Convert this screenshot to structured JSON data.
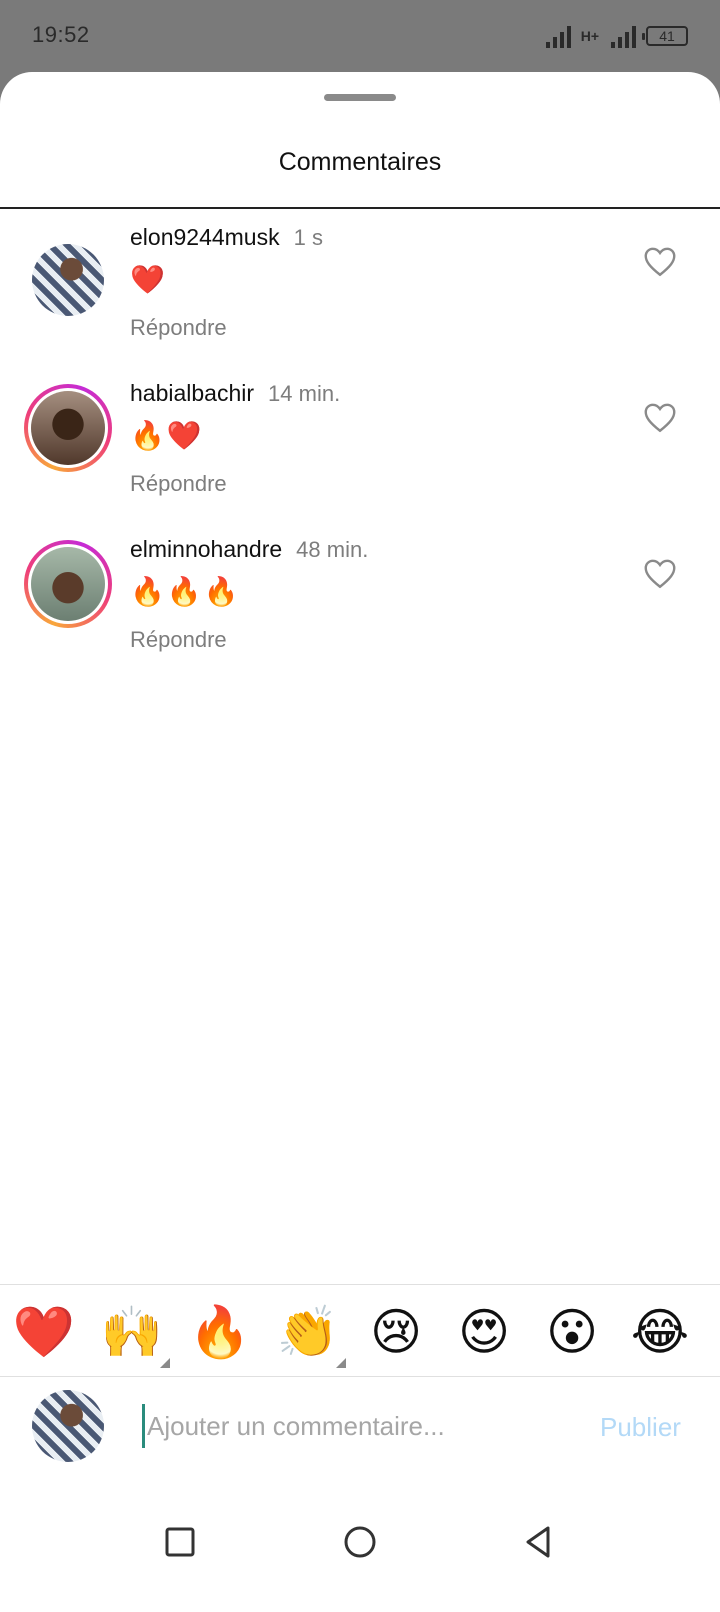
{
  "status_bar": {
    "time": "19:52",
    "network": "H+",
    "battery": "41"
  },
  "sheet": {
    "title": "Commentaires"
  },
  "comments": [
    {
      "username": "elon9244musk",
      "time": "1 s",
      "text": "❤️",
      "reply_label": "Répondre",
      "avatar": "avatar",
      "story_ring": false
    },
    {
      "username": "habialbachir",
      "time": "14 min.",
      "text": "🔥❤️",
      "reply_label": "Répondre",
      "avatar": "avatar",
      "story_ring": true
    },
    {
      "username": "elminnohandre",
      "time": "48 min.",
      "text": "🔥🔥🔥",
      "reply_label": "Répondre",
      "avatar": "avatar",
      "story_ring": true
    }
  ],
  "emoji_bar": [
    {
      "emoji": "❤️",
      "has_variants": false
    },
    {
      "emoji": "🙌",
      "has_variants": true
    },
    {
      "emoji": "🔥",
      "has_variants": false
    },
    {
      "emoji": "👏",
      "has_variants": true
    },
    {
      "emoji": "😢",
      "has_variants": false
    },
    {
      "emoji": "😍",
      "has_variants": false
    },
    {
      "emoji": "😮",
      "has_variants": false
    },
    {
      "emoji": "😂",
      "has_variants": false
    }
  ],
  "composer": {
    "placeholder": "Ajouter un commentaire...",
    "value": "",
    "publish_label": "Publier"
  },
  "nav_bar": {
    "icons": [
      "recent-apps-icon",
      "home-icon",
      "back-icon"
    ]
  },
  "colors": {
    "story_ring_start": "#f8a73b",
    "story_ring_end": "#c52bd6",
    "publish_disabled": "#b3d9f7",
    "cursor": "#2a8c7d"
  }
}
